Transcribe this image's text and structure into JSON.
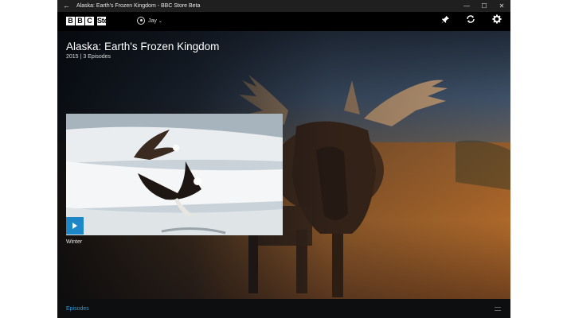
{
  "window": {
    "title": "Alaska: Earth's Frozen Kingdom - BBC Store Beta",
    "back_icon": "arrow-left-icon",
    "minimize_icon": "minimize-icon",
    "maximize_icon": "maximize-icon",
    "close_icon": "close-icon"
  },
  "appbar": {
    "brand_letters": [
      "B",
      "B",
      "C"
    ],
    "brand_word": "Store",
    "user": {
      "name": "Jay",
      "avatar_icon": "user-circle-icon",
      "chevron_icon": "chevron-down-icon"
    },
    "actions": [
      {
        "name": "pin-icon",
        "glyph": "📌"
      },
      {
        "name": "sync-icon",
        "glyph": "⟳"
      },
      {
        "name": "gear-icon",
        "glyph": "⚙"
      }
    ]
  },
  "show": {
    "title": "Alaska: Earth's Frozen Kingdom",
    "year": "2015",
    "separator": "|",
    "episodes_count": "3 Episodes"
  },
  "episode": {
    "label": "Winter",
    "play_icon": "play-icon"
  },
  "bottom": {
    "tab_label": "Episodes",
    "handle_icon": "more-handle-icon"
  },
  "colors": {
    "accent": "#1d87c8",
    "tab_text": "#2f9ad9",
    "titlebar": "#1f1f1f",
    "appbar": "#000000"
  }
}
